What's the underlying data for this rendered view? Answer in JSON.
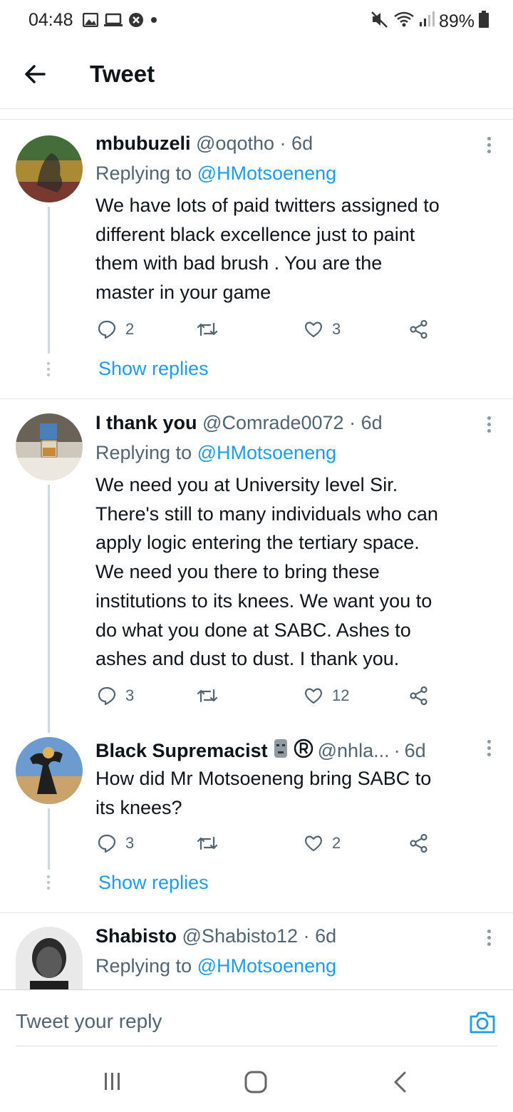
{
  "status_bar": {
    "time": "04:48",
    "battery": "89%",
    "icons_left": [
      "gallery-icon",
      "screen-icon",
      "shield-icon",
      "dot-icon"
    ],
    "icons_right": [
      "mute-icon",
      "wifi-icon",
      "signal-icon",
      "battery-icon"
    ]
  },
  "header": {
    "title": "Tweet",
    "back_icon": "arrow-left-icon"
  },
  "tweets": [
    {
      "display_name": "mbubuzeli",
      "handle": "@oqotho",
      "age": "6d",
      "replying_label": "Replying to",
      "replying_handle": "@HMotsoeneng",
      "text": "We have lots of paid twitters assigned to\ndifferent  black excellence  just to paint\nthem with bad brush . You are the\nmaster in your game",
      "replies": "2",
      "retweets": "",
      "likes": "3",
      "show_replies": "Show replies"
    },
    {
      "display_name": "I thank you",
      "handle": "@Comrade0072",
      "age": "6d",
      "replying_label": "Replying to",
      "replying_handle": "@HMotsoeneng",
      "text": "We need you at University level Sir.\nThere's still to many individuals who can\napply logic entering the tertiary space.\nWe need you there to bring these\ninstitutions to its knees. We want you to\ndo what you done at SABC. Ashes to\nashes and dust to dust. I thank you.",
      "replies": "3",
      "retweets": "",
      "likes": "12"
    },
    {
      "display_name": "Black Supremacist",
      "badges": [
        "moai-emoji",
        "registered-icon"
      ],
      "handle": "@nhla...",
      "age": "6d",
      "text": "How did Mr Motsoeneng bring SABC to\nits knees?",
      "replies": "3",
      "retweets": "",
      "likes": "2",
      "show_replies": "Show replies"
    },
    {
      "display_name": "Shabisto",
      "handle": "@Shabisto12",
      "age": "6d",
      "replying_label": "Replying to",
      "replying_handle": "@HMotsoeneng"
    }
  ],
  "reply_bar": {
    "placeholder": "Tweet your reply",
    "camera_icon": "camera-icon"
  },
  "nav_bar": {
    "icons": [
      "recents-icon",
      "home-icon",
      "back-icon"
    ]
  },
  "colors": {
    "accent": "#1d9bf0",
    "secondary_text": "#536471",
    "text": "#0f1419"
  }
}
